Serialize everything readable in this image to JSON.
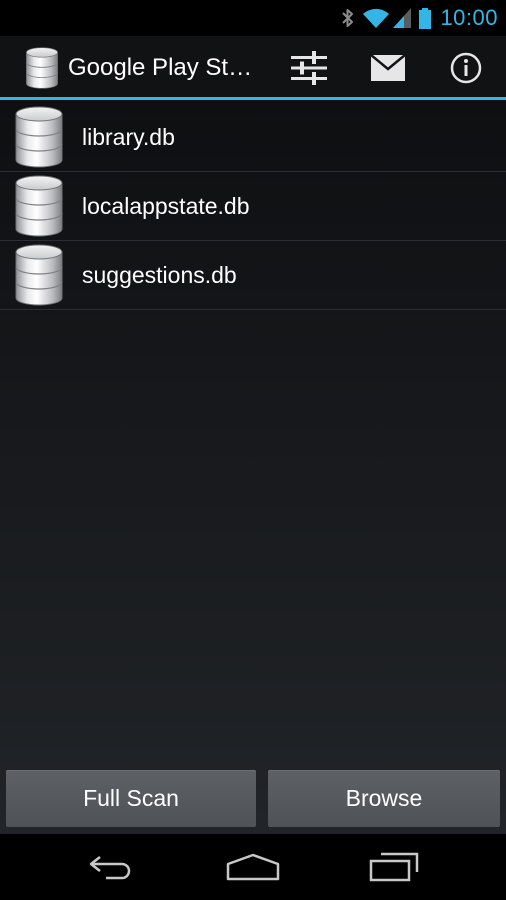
{
  "status_bar": {
    "time": "10:00",
    "icons": [
      "bluetooth-icon",
      "wifi-icon",
      "signal-icon",
      "battery-icon"
    ],
    "accent_color": "#33b5e5"
  },
  "action_bar": {
    "title": "Google Play Store",
    "app_icon": "database-icon",
    "actions": [
      "settings-sliders-icon",
      "mail-icon",
      "info-icon"
    ],
    "accent_color": "#33b5e5"
  },
  "files": [
    {
      "name": "library.db",
      "icon": "database-icon"
    },
    {
      "name": "localappstate.db",
      "icon": "database-icon"
    },
    {
      "name": "suggestions.db",
      "icon": "database-icon"
    }
  ],
  "buttons": {
    "full_scan": "Full Scan",
    "browse": "Browse"
  },
  "nav_bar": {
    "icons": [
      "back-icon",
      "home-icon",
      "recent-apps-icon"
    ]
  }
}
